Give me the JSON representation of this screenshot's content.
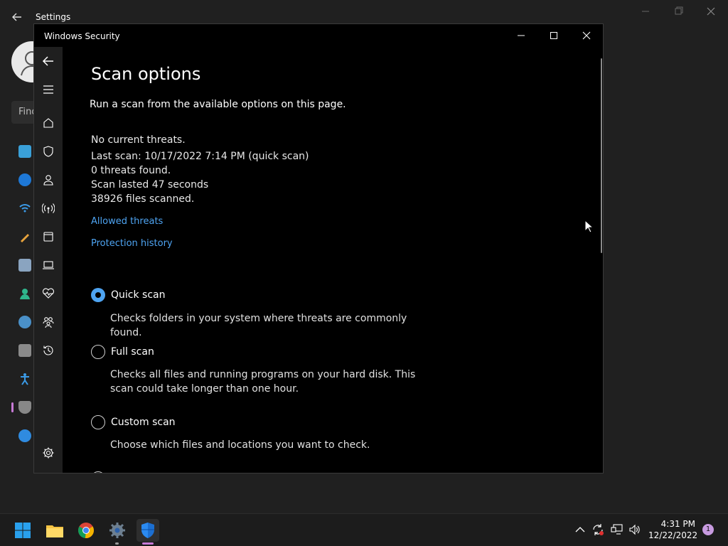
{
  "settings": {
    "title": "Settings",
    "search_placeholder": "Find"
  },
  "security_window": {
    "title": "Windows Security",
    "page_title": "Scan options",
    "subtitle": "Run a scan from the available options on this page.",
    "status_lines": [
      "No current threats.",
      "Last scan: 10/17/2022 7:14 PM (quick scan)",
      "0 threats found.",
      "Scan lasted 47 seconds",
      "38926 files scanned."
    ],
    "links": {
      "allowed_threats": "Allowed threats",
      "protection_history": "Protection history"
    },
    "scan_options": [
      {
        "label": "Quick scan",
        "description": "Checks folders in your system where threats are commonly found.",
        "selected": true
      },
      {
        "label": "Full scan",
        "description": "Checks all files and running programs on your hard disk. This scan could take longer than one hour.",
        "selected": false
      },
      {
        "label": "Custom scan",
        "description": "Choose which files and locations you want to check.",
        "selected": false
      }
    ]
  },
  "taskbar": {
    "time": "4:31 PM",
    "date": "12/22/2022",
    "notification_count": "1"
  },
  "colors": {
    "accent": "#4ea4f2",
    "background": "#000000",
    "nav_background": "#1f1f1f",
    "indicator": "#c77ad6"
  }
}
